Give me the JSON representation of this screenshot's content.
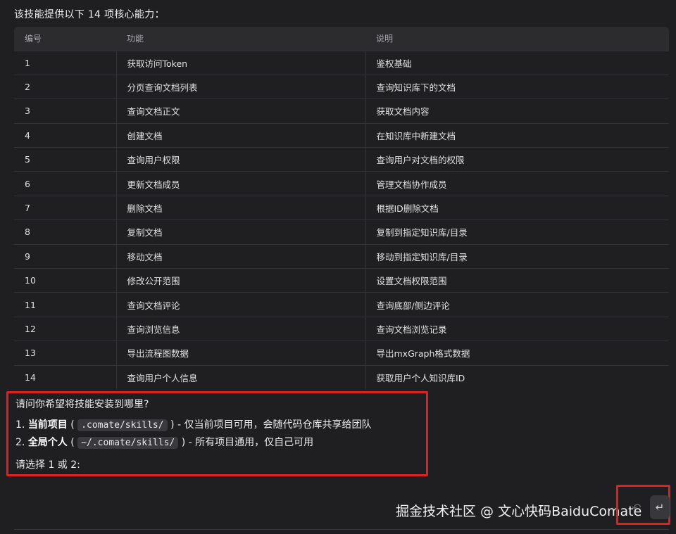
{
  "intro": "该技能提供以下 14 项核心能力：",
  "table": {
    "headers": [
      "编号",
      "功能",
      "说明"
    ],
    "rows": [
      [
        "1",
        "获取访问Token",
        "鉴权基础"
      ],
      [
        "2",
        "分页查询文档列表",
        "查询知识库下的文档"
      ],
      [
        "3",
        "查询文档正文",
        "获取文档内容"
      ],
      [
        "4",
        "创建文档",
        "在知识库中新建文档"
      ],
      [
        "5",
        "查询用户权限",
        "查询用户对文档的权限"
      ],
      [
        "6",
        "更新文档成员",
        "管理文档协作成员"
      ],
      [
        "7",
        "删除文档",
        "根据ID删除文档"
      ],
      [
        "8",
        "复制文档",
        "复制到指定知识库/目录"
      ],
      [
        "9",
        "移动文档",
        "移动到指定知识库/目录"
      ],
      [
        "10",
        "修改公开范围",
        "设置文档权限范围"
      ],
      [
        "11",
        "查询文档评论",
        "查询底部/侧边评论"
      ],
      [
        "12",
        "查询浏览信息",
        "查询文档浏览记录"
      ],
      [
        "13",
        "导出流程图数据",
        "导出mxGraph格式数据"
      ],
      [
        "14",
        "查询用户个人信息",
        "获取用户个人知识库ID"
      ]
    ]
  },
  "prompt": {
    "question": "请问你希望将技能安装到哪里?",
    "option1": {
      "prefix": "1. ",
      "title": "当前项目",
      "open": " ( ",
      "path": ".comate/skills/",
      "close": " ) ",
      "desc": "- 仅当前项目可用，会随代码仓库共享给团队"
    },
    "option2": {
      "prefix": "2. ",
      "title": "全局个人",
      "open": " ( ",
      "path": "~/.comate/skills/",
      "close": " ) ",
      "desc": "- 所有项目通用，仅自己可用"
    },
    "ask": "请选择 1 或 2:"
  },
  "watermark": "掘金技术社区 @ 文心快码BaiduComate",
  "icons": {
    "undo": "undo-icon",
    "send": "enter-icon"
  },
  "colors": {
    "highlight_border": "#e0201f",
    "background": "#1f1f21",
    "header_bg": "#2c2c2f"
  }
}
